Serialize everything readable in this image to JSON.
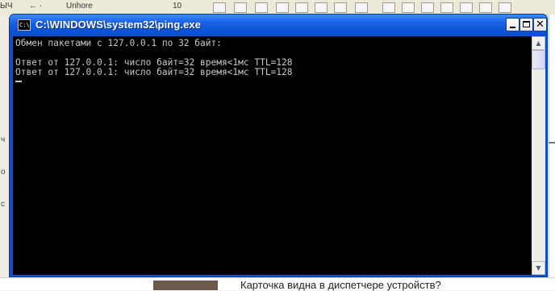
{
  "background_app": {
    "toolbar_fragments": [
      "ЫЧ",
      "← ·",
      "Unhore",
      "10"
    ],
    "left_fragments": [
      "ч",
      "о",
      "с"
    ],
    "bottom_text": "Карточка видна в диспетчере устройств?"
  },
  "window": {
    "title": "C:\\WINDOWS\\system32\\ping.exe",
    "icon_label": "C:\\",
    "controls": {
      "minimize": "minimize",
      "maximize": "maximize",
      "close": "✕"
    }
  },
  "console": {
    "lines": [
      "Обмен пакетами с 127.0.0.1 по 32 байт:",
      "",
      "Ответ от 127.0.0.1: число байт=32 время<1мс TTL=128",
      "Ответ от 127.0.0.1: число байт=32 время<1мс TTL=128"
    ]
  },
  "scrollbar": {
    "up": "▲",
    "down": "▼"
  }
}
